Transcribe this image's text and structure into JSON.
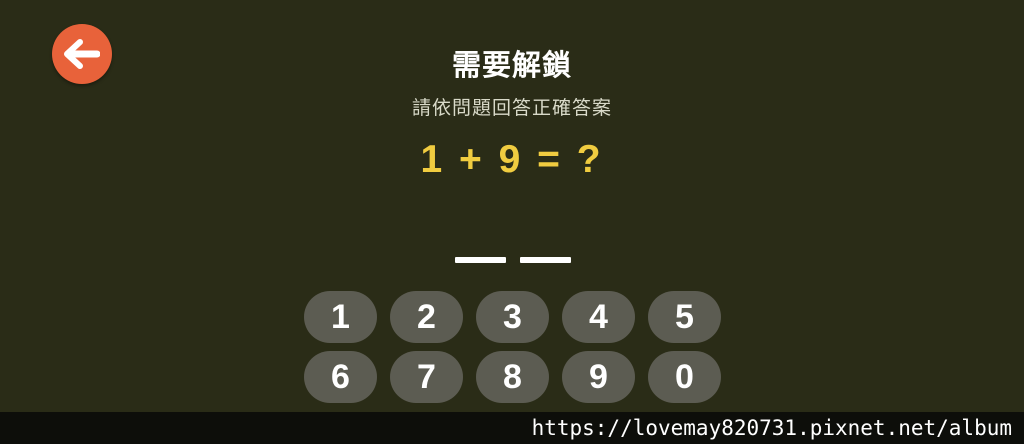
{
  "header": {
    "back_icon": "arrow-left-icon",
    "title": "需要解鎖",
    "subtitle": "請依問題回答正確答案"
  },
  "question": {
    "text": "1 + 9 = ?"
  },
  "answer": {
    "slot_count": 2
  },
  "keypad": {
    "keys": [
      "1",
      "2",
      "3",
      "4",
      "5",
      "6",
      "7",
      "8",
      "9",
      "0"
    ]
  },
  "watermark": {
    "text": "https://lovemay820731.pixnet.net/album"
  },
  "colors": {
    "background": "#2a2c17",
    "accent": "#e8623a",
    "question": "#f0cc40",
    "key": "#5c5c52"
  }
}
